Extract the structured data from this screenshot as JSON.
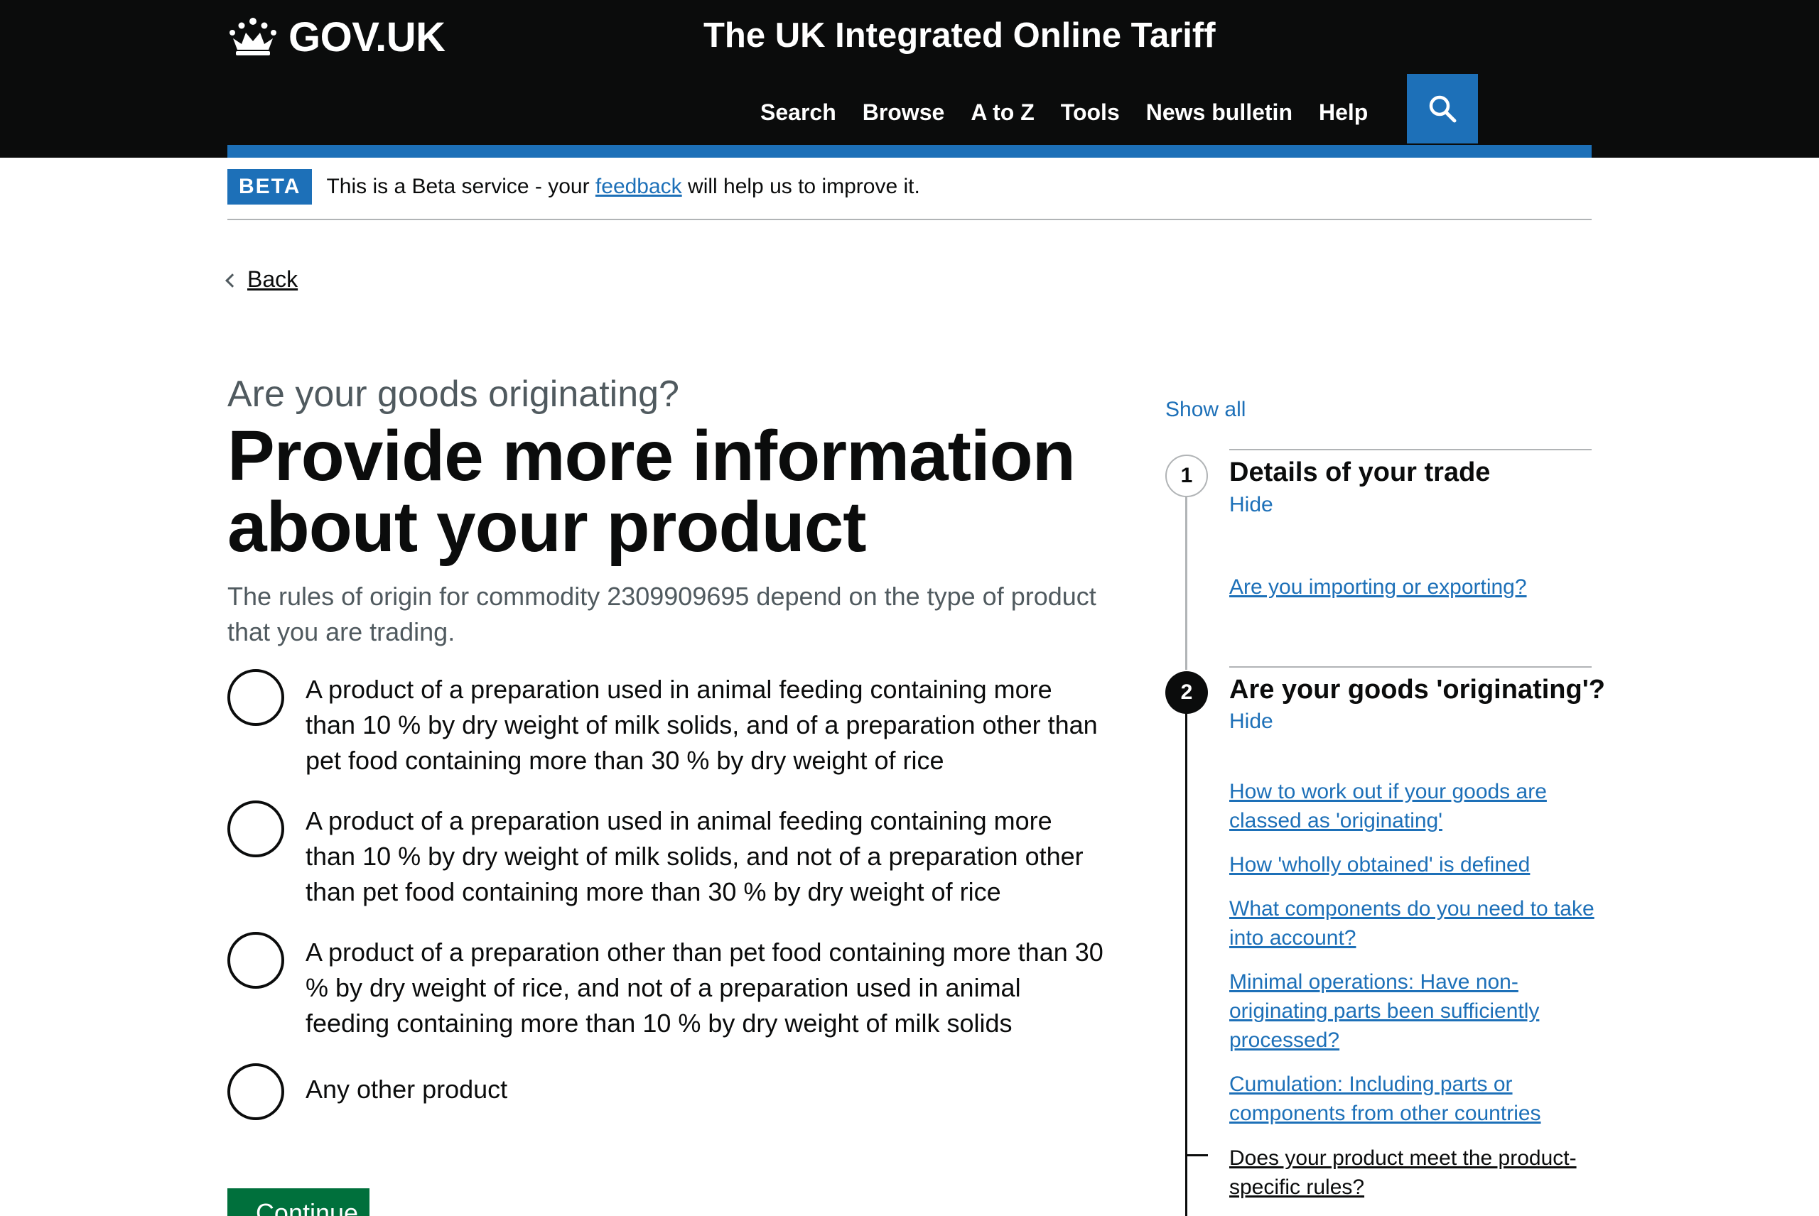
{
  "header": {
    "logo_text": "GOV.UK",
    "service_name": "The UK Integrated Online Tariff",
    "nav": [
      "Search",
      "Browse",
      "A to Z",
      "Tools",
      "News bulletin",
      "Help"
    ],
    "search_icon": "search-icon"
  },
  "beta": {
    "tag": "BETA",
    "text_before": "This is a Beta service - your ",
    "link": "feedback",
    "text_after": " will help us to improve it."
  },
  "back_link": "Back",
  "main": {
    "caption": "Are your goods originating?",
    "heading": "Provide more information about your product",
    "hint": "The rules of origin for commodity 2309909695 depend on the type of product that you are trading.",
    "options": [
      "A product of a preparation used in animal feeding containing more than 10 % by dry weight of milk solids, and of a preparation other than pet food containing more than 30 % by dry weight of rice",
      "A product of a preparation used in animal feeding containing more than 10 % by dry weight of milk solids, and not of a preparation other than pet food containing more than 30 % by dry weight of rice",
      "A product of a preparation other than pet food containing more than 30 % by dry weight of rice, and not of a preparation used in animal feeding containing more than 10 % by dry weight of milk solids",
      "Any other product"
    ],
    "continue_label": "Continue"
  },
  "steps": {
    "show_all": "Show all",
    "items": [
      {
        "number": "1",
        "title": "Details of your trade",
        "hide": "Hide",
        "links": [
          "Are you importing or exporting?"
        ]
      },
      {
        "number": "2",
        "title": "Are your goods 'originating'?",
        "hide": "Hide",
        "links": [
          "How to work out if your goods are classed as 'originating'",
          "How 'wholly obtained' is defined",
          "What components do you need to take into account?",
          "Minimal operations: Have non-originating parts been sufficiently processed?",
          "Cumulation: Including parts or components from other countries",
          "Does your product meet the product-specific rules?"
        ]
      }
    ]
  },
  "colors": {
    "header_bg": "#0b0c0c",
    "brand_blue": "#1d70b8",
    "button_green": "#00703c",
    "secondary_text": "#505a5f"
  }
}
